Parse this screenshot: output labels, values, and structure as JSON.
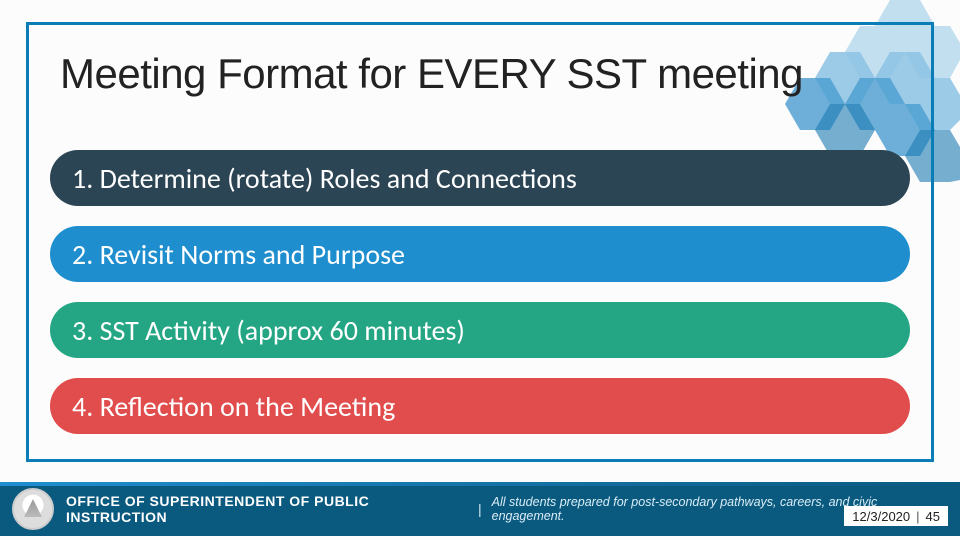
{
  "title": "Meeting Format for EVERY SST meeting",
  "items": [
    {
      "label": "1. Determine (rotate) Roles and Connections"
    },
    {
      "label": "2. Revisit Norms and Purpose"
    },
    {
      "label": "3. SST Activity (approx 60 minutes)"
    },
    {
      "label": "4. Reflection on the Meeting"
    }
  ],
  "footer": {
    "office": "OFFICE OF SUPERINTENDENT OF PUBLIC INSTRUCTION",
    "tagline": "All students prepared for post-secondary pathways, careers, and civic engagement.",
    "date": "12/3/2020",
    "page": "45"
  },
  "colors": {
    "frame": "#0a7db6",
    "pills": [
      "#2b4554",
      "#1f8ecf",
      "#24a684",
      "#e14c4c"
    ],
    "footer": "#0a5a80"
  }
}
